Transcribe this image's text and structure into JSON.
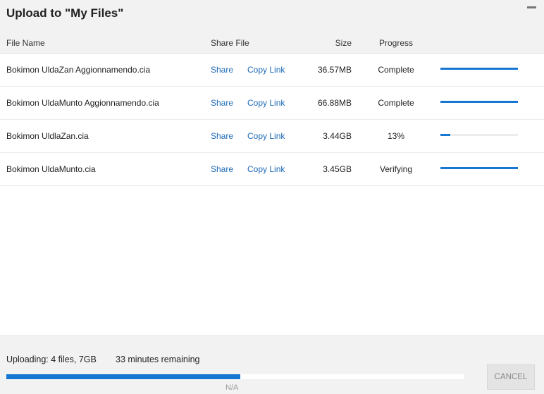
{
  "window": {
    "title": "Upload to \"My Files\"",
    "minimize_icon": "minimize-icon"
  },
  "columns": {
    "name": "File Name",
    "share": "Share File",
    "size": "Size",
    "progress": "Progress"
  },
  "files": [
    {
      "name": "Bokimon UldaZan Aggionnamendo.cia",
      "share": "Share",
      "copy": "Copy Link",
      "size": "36.57MB",
      "status": "Complete",
      "progress": 1.0
    },
    {
      "name": "Bokimon UldaMunto Aggionnamendo.cia",
      "share": "Share",
      "copy": "Copy Link",
      "size": "66.88MB",
      "status": "Complete",
      "progress": 1.0
    },
    {
      "name": "Bokimon UldlaZan.cia",
      "share": "Share",
      "copy": "Copy Link",
      "size": "3.44GB",
      "status": "13%",
      "progress": 0.13
    },
    {
      "name": "Bokimon UldaMunto.cia",
      "share": "Share",
      "copy": "Copy Link",
      "size": "3.45GB",
      "status": "Verifying",
      "progress": 1.0
    }
  ],
  "footer": {
    "uploading": "Uploading: 4 files, 7GB",
    "remaining": "33 minutes remaining",
    "speed": "N/A",
    "overall_progress": 0.51,
    "cancel_label": "CANCEL"
  },
  "colors": {
    "accent": "#1677d2",
    "link": "#1e6bb8"
  }
}
